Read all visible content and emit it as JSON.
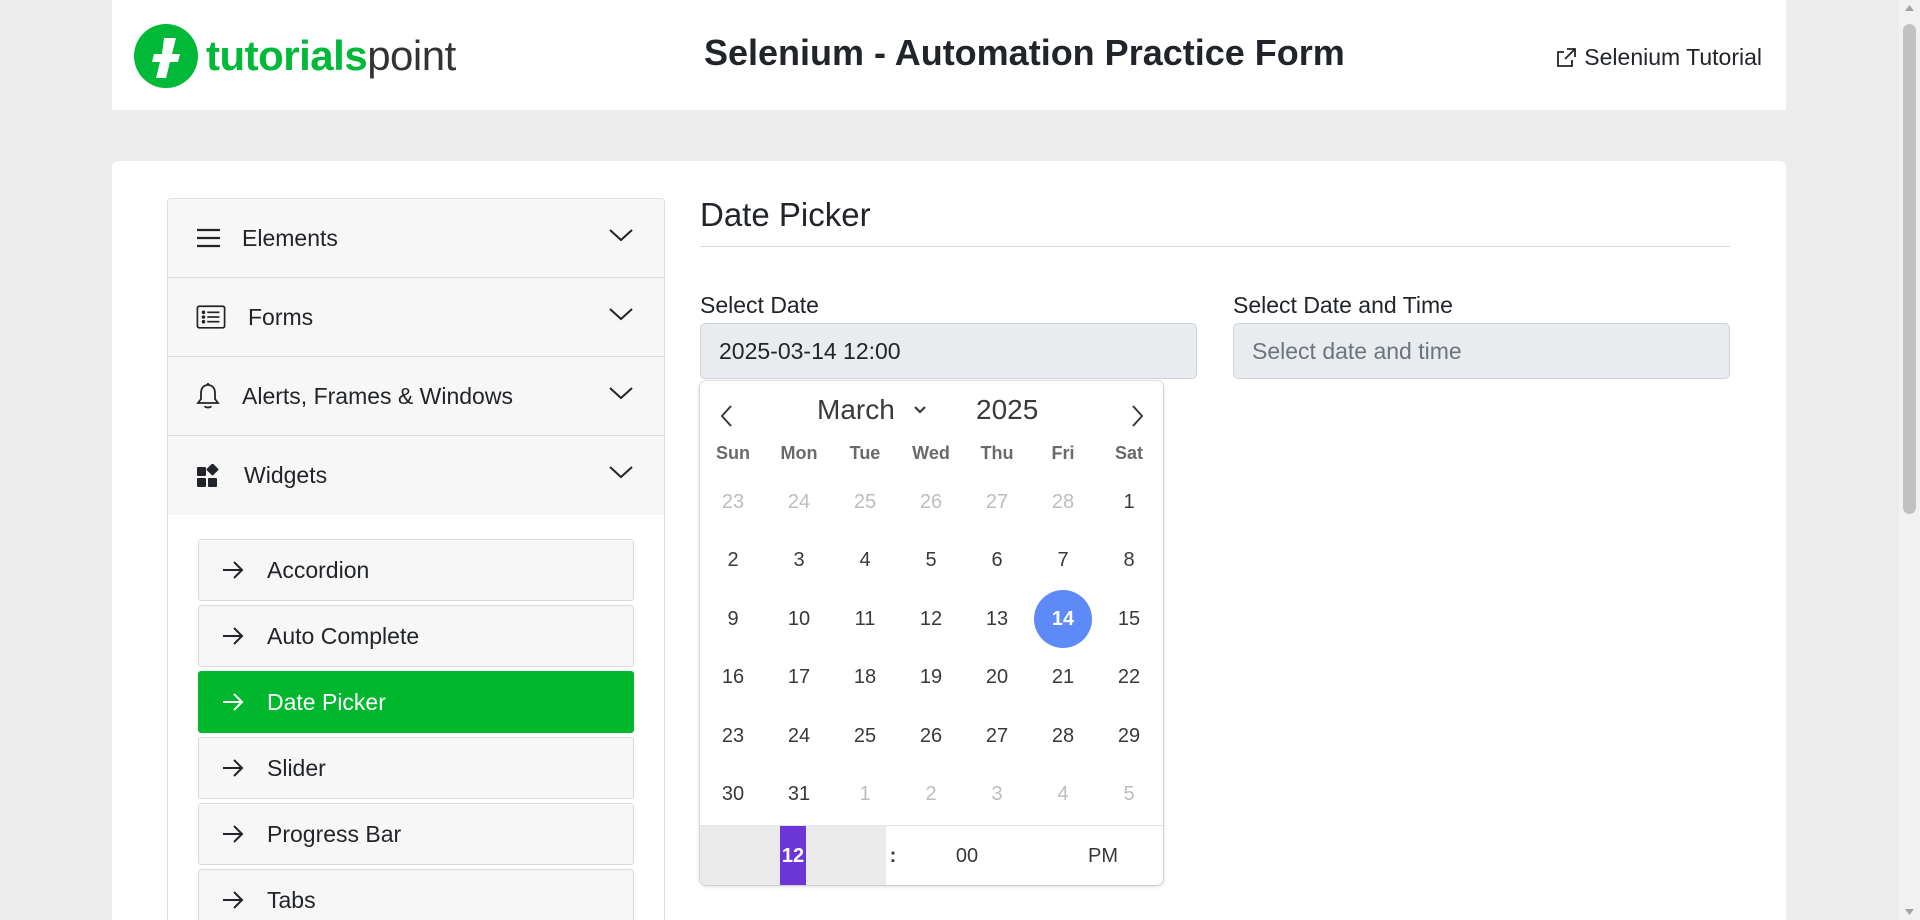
{
  "header": {
    "logo_part1": "tutorials",
    "logo_part2": "point",
    "title": "Selenium - Automation Practice Form",
    "tutorial_link": "Selenium Tutorial",
    "brand_color": "#00b938"
  },
  "sidebar": {
    "sections": [
      {
        "label": "Elements",
        "icon": "hamburger-icon"
      },
      {
        "label": "Forms",
        "icon": "form-list-icon"
      },
      {
        "label": "Alerts, Frames & Windows",
        "icon": "bell-icon"
      },
      {
        "label": "Widgets",
        "icon": "widgets-icon"
      }
    ],
    "widgets": [
      {
        "label": "Accordion",
        "active": false
      },
      {
        "label": "Auto Complete",
        "active": false
      },
      {
        "label": "Date Picker",
        "active": true
      },
      {
        "label": "Slider",
        "active": false
      },
      {
        "label": "Progress Bar",
        "active": false
      },
      {
        "label": "Tabs",
        "active": false
      }
    ],
    "active_color": "#00b72e"
  },
  "content": {
    "title": "Date Picker",
    "select_date_label": "Select Date",
    "select_date_value": "2025-03-14 12:00",
    "select_datetime_label": "Select Date and Time",
    "select_datetime_placeholder": "Select date and time"
  },
  "calendar": {
    "month": "March",
    "year": "2025",
    "weekdays": [
      "Sun",
      "Mon",
      "Tue",
      "Wed",
      "Thu",
      "Fri",
      "Sat"
    ],
    "weeks": [
      [
        [
          "23",
          "muted"
        ],
        [
          "24",
          "muted"
        ],
        [
          "25",
          "muted"
        ],
        [
          "26",
          "muted"
        ],
        [
          "27",
          "muted"
        ],
        [
          "28",
          "muted"
        ],
        [
          "1",
          ""
        ]
      ],
      [
        [
          "2",
          ""
        ],
        [
          "3",
          ""
        ],
        [
          "4",
          ""
        ],
        [
          "5",
          ""
        ],
        [
          "6",
          ""
        ],
        [
          "7",
          ""
        ],
        [
          "8",
          ""
        ]
      ],
      [
        [
          "9",
          ""
        ],
        [
          "10",
          ""
        ],
        [
          "11",
          ""
        ],
        [
          "12",
          ""
        ],
        [
          "13",
          ""
        ],
        [
          "14",
          "selected"
        ],
        [
          "15",
          ""
        ]
      ],
      [
        [
          "16",
          ""
        ],
        [
          "17",
          ""
        ],
        [
          "18",
          ""
        ],
        [
          "19",
          ""
        ],
        [
          "20",
          ""
        ],
        [
          "21",
          ""
        ],
        [
          "22",
          ""
        ]
      ],
      [
        [
          "23",
          ""
        ],
        [
          "24",
          ""
        ],
        [
          "25",
          ""
        ],
        [
          "26",
          ""
        ],
        [
          "27",
          ""
        ],
        [
          "28",
          ""
        ],
        [
          "29",
          ""
        ]
      ],
      [
        [
          "30",
          ""
        ],
        [
          "31",
          ""
        ],
        [
          "1",
          "muted"
        ],
        [
          "2",
          "muted"
        ],
        [
          "3",
          "muted"
        ],
        [
          "4",
          "muted"
        ],
        [
          "5",
          "muted"
        ]
      ]
    ],
    "hour": "12",
    "separator": ":",
    "minute": "00",
    "ampm": "PM",
    "selected_color": "#5e8af7",
    "hour_highlight_color": "#6b35d7"
  }
}
